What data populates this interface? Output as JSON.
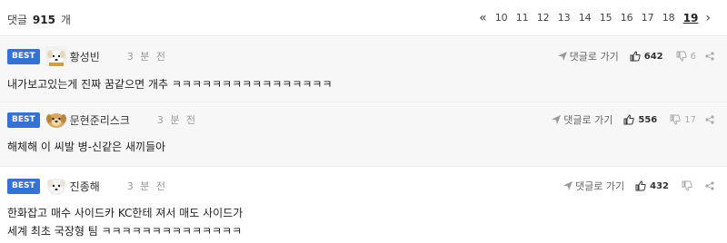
{
  "header": {
    "count_prefix": "댓글",
    "count_value": "915",
    "count_suffix": "개",
    "first_arrow": "«",
    "next_arrow": "›",
    "pages": [
      "10",
      "11",
      "12",
      "13",
      "14",
      "15",
      "16",
      "17",
      "18",
      "19"
    ],
    "current_page": "19"
  },
  "comments": [
    {
      "badge": "BEST",
      "avatar_icon": "white-dog-avatar",
      "nickname": "황성빈",
      "time": "3 분 전",
      "reply_label": "댓글로 가기",
      "likes": "642",
      "dislikes": "6",
      "text_lines": [
        "내가보고있는게 진짜 꿈같으면 개추 ㅋㅋㅋㅋㅋㅋㅋㅋㅋㅋㅋㅋㅋㅋㅋㅋ"
      ]
    },
    {
      "badge": "BEST",
      "avatar_icon": "brown-dog-avatar",
      "nickname": "문현준리스크",
      "time": "3 분 전",
      "reply_label": "댓글로 가기",
      "likes": "556",
      "dislikes": "17",
      "text_lines": [
        "해체해 이 씨발 병-신같은 새끼들아"
      ]
    },
    {
      "badge": "BEST",
      "avatar_icon": "white-dog-avatar",
      "nickname": "진종해",
      "time": "3 분 전",
      "reply_label": "댓글로 가기",
      "likes": "432",
      "dislikes": "",
      "text_lines": [
        "한화잡고 매수 사이드카 KC한테 져서 매도 사이드가",
        "세계 최초 국장형 팀 ㅋㅋㅋㅋㅋㅋㅋㅋㅋㅋㅋㅋㅋㅋ"
      ]
    }
  ],
  "colors": {
    "best_badge": "#3572d3",
    "best_bg": "#f7f7f7"
  }
}
